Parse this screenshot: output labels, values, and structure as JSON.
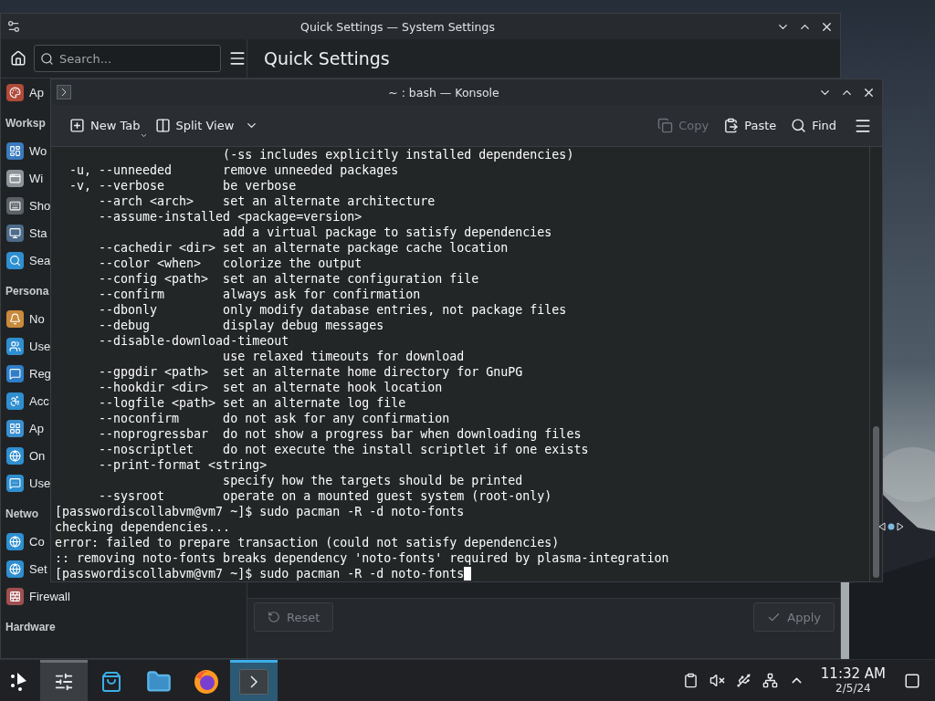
{
  "settings_window": {
    "title": "Quick Settings — System Settings",
    "search": {
      "placeholder": "Search..."
    },
    "page_title": "Quick Settings",
    "sidebar": [
      {
        "kind": "item",
        "label": "Ap"
      },
      {
        "kind": "heading",
        "label": "Worksp"
      },
      {
        "kind": "item",
        "label": "Wo"
      },
      {
        "kind": "item",
        "label": "Wi"
      },
      {
        "kind": "item",
        "label": "Sho"
      },
      {
        "kind": "item",
        "label": "Sta"
      },
      {
        "kind": "item",
        "label": "Sea"
      },
      {
        "kind": "heading",
        "label": "Persona"
      },
      {
        "kind": "item",
        "label": "No"
      },
      {
        "kind": "item",
        "label": "Use"
      },
      {
        "kind": "item",
        "label": "Reg"
      },
      {
        "kind": "item",
        "label": "Acc"
      },
      {
        "kind": "item",
        "label": "Ap"
      },
      {
        "kind": "item",
        "label": "On"
      },
      {
        "kind": "item",
        "label": "Use"
      },
      {
        "kind": "heading",
        "label": "Netwo"
      },
      {
        "kind": "item",
        "label": "Co"
      },
      {
        "kind": "item",
        "label": "Set"
      },
      {
        "kind": "item",
        "label": "Firewall"
      },
      {
        "kind": "heading",
        "label": "Hardware"
      }
    ],
    "footer": {
      "reset": {
        "label": "Reset",
        "disabled": true
      },
      "apply": {
        "label": "Apply",
        "disabled": true
      }
    }
  },
  "konsole_window": {
    "title": "~ : bash — Konsole",
    "toolbar": [
      {
        "kind": "new-tab",
        "label": "New Tab",
        "disabled": false
      },
      {
        "kind": "split-view",
        "label": "Split View",
        "disabled": false
      },
      {
        "kind": "copy",
        "label": "Copy",
        "disabled": true
      },
      {
        "kind": "paste",
        "label": "Paste",
        "disabled": false
      },
      {
        "kind": "find",
        "label": "Find",
        "disabled": false
      }
    ],
    "terminal": {
      "cursor": true,
      "lines": [
        "                       (-ss includes explicitly installed dependencies)",
        "  -u, --unneeded       remove unneeded packages",
        "  -v, --verbose        be verbose",
        "      --arch <arch>    set an alternate architecture",
        "      --assume-installed <package=version>",
        "                       add a virtual package to satisfy dependencies",
        "      --cachedir <dir> set an alternate package cache location",
        "      --color <when>   colorize the output",
        "      --config <path>  set an alternate configuration file",
        "      --confirm        always ask for confirmation",
        "      --dbonly         only modify database entries, not package files",
        "      --debug          display debug messages",
        "      --disable-download-timeout",
        "                       use relaxed timeouts for download",
        "      --gpgdir <path>  set an alternate home directory for GnuPG",
        "      --hookdir <dir>  set an alternate hook location",
        "      --logfile <path> set an alternate log file",
        "      --noconfirm      do not ask for any confirmation",
        "      --noprogressbar  do not show a progress bar when downloading files",
        "      --noscriptlet    do not execute the install scriptlet if one exists",
        "      --print-format <string>",
        "                       specify how the targets should be printed",
        "      --sysroot        operate on a mounted guest system (root-only)",
        "[passwordiscollabvm@vm7 ~]$ sudo pacman -R -d noto-fonts",
        "checking dependencies...",
        "error: failed to prepare transaction (could not satisfy dependencies)",
        ":: removing noto-fonts breaks dependency 'noto-fonts' required by plasma-integration",
        "[passwordiscollabvm@vm7 ~]$ sudo pacman -R -d noto-fonts"
      ]
    }
  },
  "taskbar": {
    "tasks": [
      {
        "kind": "settings",
        "open": true,
        "selected": false
      },
      {
        "kind": "store",
        "open": false,
        "selected": false
      },
      {
        "kind": "files",
        "open": false,
        "selected": false
      },
      {
        "kind": "browser",
        "open": false,
        "selected": false
      },
      {
        "kind": "terminal",
        "open": true,
        "selected": true
      }
    ],
    "clock": {
      "time": "11:32 AM",
      "date": "2/5/24"
    }
  }
}
